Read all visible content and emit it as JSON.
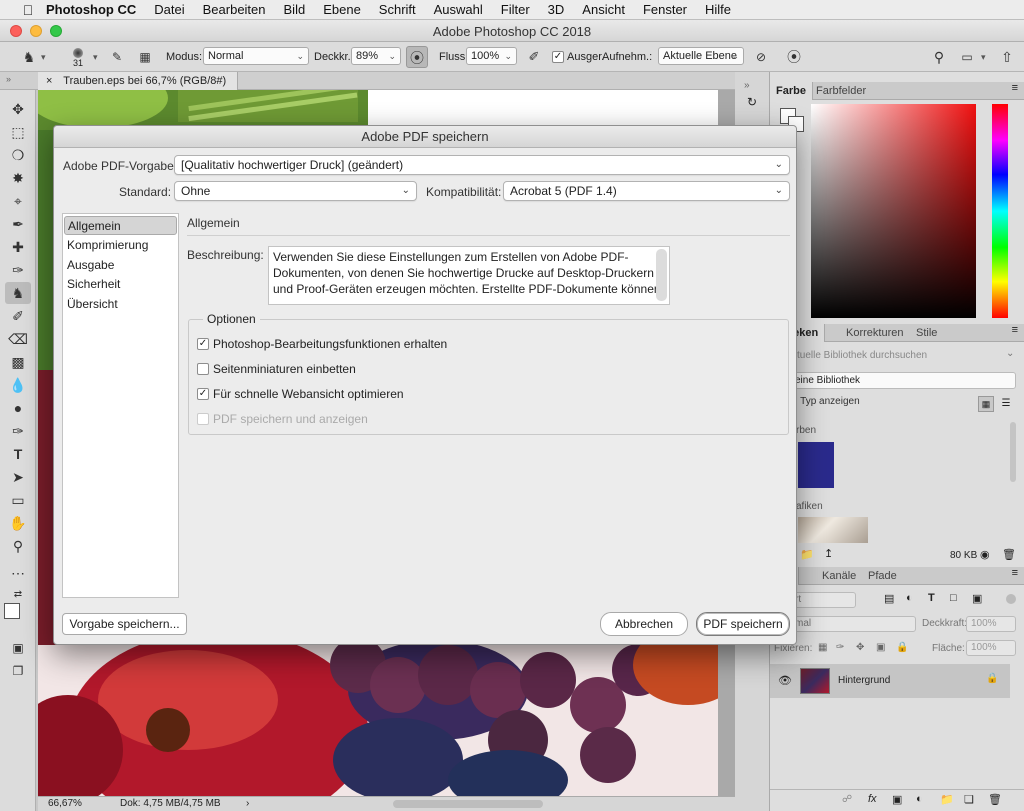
{
  "menubar": {
    "app": "Photoshop CC",
    "items": [
      "Datei",
      "Bearbeiten",
      "Bild",
      "Ebene",
      "Schrift",
      "Auswahl",
      "Filter",
      "3D",
      "Ansicht",
      "Fenster",
      "Hilfe"
    ]
  },
  "window": {
    "title": "Adobe Photoshop CC 2018"
  },
  "options_bar": {
    "brush_size": "31",
    "modus_label": "Modus:",
    "modus_value": "Normal",
    "deckkr_label": "Deckkr.:",
    "deckkr_value": "89%",
    "fluss_label": "Fluss:",
    "fluss_value": "100%",
    "ausger_label": "Ausger.",
    "aufnehm_label": "Aufnehm.:",
    "aufnehm_value": "Aktuelle Ebene"
  },
  "doc_tab": {
    "close": "×",
    "title": "Trauben.eps bei 66,7% (RGB/8#)"
  },
  "status_bar": {
    "zoom": "66,67%",
    "doc": "Dok: 4,75 MB/4,75 MB",
    "arrow": "›"
  },
  "panels": {
    "color_tabs": [
      "Farbe",
      "Farbfelder"
    ],
    "library_tabs": [
      "otheken",
      "Korrekturen",
      "Stile"
    ],
    "library_search_placeholder": "ktuelle Bibliothek durchsuchen",
    "library_select": "eine Bibliothek",
    "library_filter": "n Typ anzeigen",
    "library_section_colors": "rben",
    "library_section_graphics": "afiken",
    "library_size": "80 KB",
    "layers_tabs": [
      "ien",
      "Kanäle",
      "Pfade"
    ],
    "layers_kind": "rt",
    "layers_mode": "mal",
    "deckkraft_label": "Deckkraft:",
    "deckkraft_value": "100%",
    "fixieren_label": "Fixieren:",
    "flaeche_label": "Fläche:",
    "flaeche_value": "100%",
    "layer_name": "Hintergrund"
  },
  "dialog": {
    "title": "Adobe PDF speichern",
    "preset_label": "Adobe PDF-Vorgabe:",
    "preset_value": "[Qualitativ hochwertiger Druck] (geändert)",
    "standard_label": "Standard:",
    "standard_value": "Ohne",
    "compat_label": "Kompatibilität:",
    "compat_value": "Acrobat 5 (PDF 1.4)",
    "categories": [
      "Allgemein",
      "Komprimierung",
      "Ausgabe",
      "Sicherheit",
      "Übersicht"
    ],
    "selected_category": "Allgemein",
    "section_title": "Allgemein",
    "desc_label": "Beschreibung:",
    "desc_text": "Verwenden Sie diese Einstellungen zum Erstellen von Adobe PDF-Dokumenten, von denen Sie hochwertige Drucke auf Desktop-Druckern und Proof-Geräten erzeugen möchten. Erstellte PDF-Dokumente können",
    "options_title": "Optionen",
    "options": [
      {
        "label": "Photoshop-Bearbeitungsfunktionen erhalten",
        "checked": true,
        "enabled": true
      },
      {
        "label": "Seitenminiaturen einbetten",
        "checked": false,
        "enabled": true
      },
      {
        "label": "Für schnelle Webansicht optimieren",
        "checked": true,
        "enabled": true
      },
      {
        "label": "PDF speichern und anzeigen",
        "checked": false,
        "enabled": false
      }
    ],
    "save_preset_button": "Vorgabe speichern...",
    "cancel_button": "Abbrechen",
    "save_button": "PDF speichern"
  },
  "colors": {
    "accent_blue": "#2a2a8c",
    "dialog_bg": "#ececec"
  }
}
